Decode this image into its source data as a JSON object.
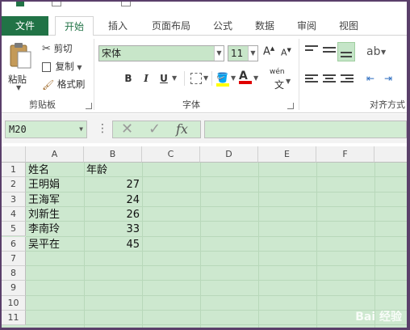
{
  "ribbon_tabs": [
    {
      "label": "文件"
    },
    {
      "label": "开始"
    },
    {
      "label": "插入"
    },
    {
      "label": "页面布局"
    },
    {
      "label": "公式"
    },
    {
      "label": "数据"
    },
    {
      "label": "审阅"
    },
    {
      "label": "视图"
    }
  ],
  "clipboard": {
    "paste": "粘贴",
    "cut": "剪切",
    "copy": "复制",
    "format_painter": "格式刷",
    "group": "剪贴板"
  },
  "font": {
    "name": "宋体",
    "size": "11",
    "bold": "B",
    "italic": "I",
    "underline": "U",
    "phonetic": "wén",
    "group": "字体"
  },
  "alignment": {
    "group": "对齐方式"
  },
  "formula_bar": {
    "name_box": "M20",
    "fx": "fx",
    "value": ""
  },
  "sheet": {
    "columns": [
      "A",
      "B",
      "C",
      "D",
      "E",
      "F"
    ],
    "rows": [
      "1",
      "2",
      "3",
      "4",
      "5",
      "6",
      "7",
      "8",
      "9",
      "10",
      "11"
    ],
    "header": [
      "姓名",
      "年龄"
    ],
    "records": [
      {
        "name": "王明娟",
        "age": "27"
      },
      {
        "name": "王海军",
        "age": "24"
      },
      {
        "name": "刘新生",
        "age": "26"
      },
      {
        "name": "李南玲",
        "age": "33"
      },
      {
        "name": "吴平在",
        "age": "45"
      }
    ]
  },
  "watermark": "Bai 经验",
  "colors": {
    "accent": "#217346",
    "selection": "#cde8cf"
  }
}
